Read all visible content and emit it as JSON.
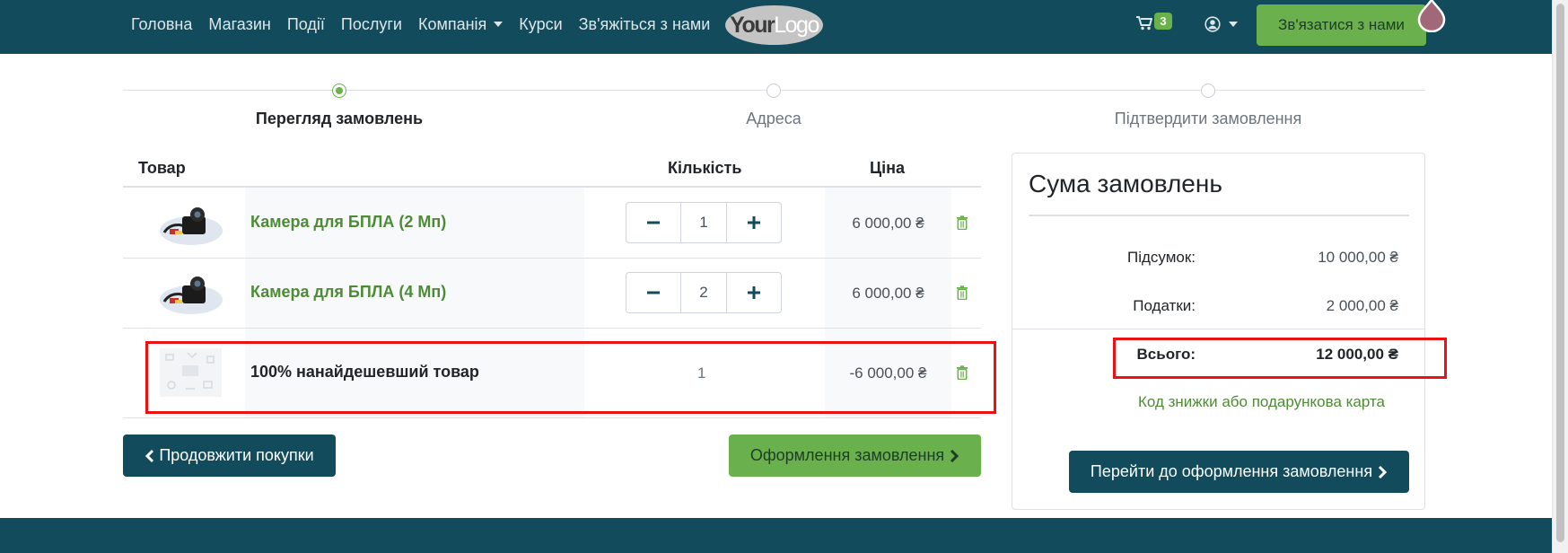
{
  "nav": {
    "links": [
      "Головна",
      "Магазин",
      "Події",
      "Послуги",
      "Компанія",
      "Курси",
      "Зв'яжіться з нами"
    ],
    "logo": {
      "bold": "Your",
      "light": "Logo"
    },
    "cart_count": "3",
    "contact_button": "Зв'язатися з нами"
  },
  "steps": [
    {
      "label": "Перегляд замовлень",
      "active": true
    },
    {
      "label": "Адреса",
      "active": false
    },
    {
      "label": "Підтвердити замовлення",
      "active": false
    }
  ],
  "table": {
    "headers": {
      "product": "Товар",
      "quantity": "Кількість",
      "price": "Ціна"
    },
    "rows": [
      {
        "name": "Камера для БПЛА (2 Мп)",
        "quantity": "1",
        "price": "6 000,00 ₴",
        "kind": "product"
      },
      {
        "name": "Камера для БПЛА (4 Мп)",
        "quantity": "2",
        "price": "6 000,00 ₴",
        "kind": "product"
      },
      {
        "name": "100% нанайдешевший товар",
        "quantity": "1",
        "price": "-6 000,00 ₴",
        "kind": "discount"
      }
    ]
  },
  "actions": {
    "continue_shopping": "Продовжити покупки",
    "checkout": "Оформлення замовлення"
  },
  "summary": {
    "title": "Сума замовлень",
    "subtotal_label": "Підсумок:",
    "subtotal_value": "10 000,00 ₴",
    "taxes_label": "Податки:",
    "taxes_value": "2 000,00 ₴",
    "total_label": "Всього:",
    "total_value": "12 000,00 ₴",
    "discount_link": "Код знижки або подарункова карта",
    "proceed_button": "Перейти до оформлення замовлення"
  },
  "colors": {
    "navbar": "#124b5c",
    "accent_green": "#6ab04c",
    "link_green": "#4e8b36",
    "highlight_red": "#ea1212"
  }
}
